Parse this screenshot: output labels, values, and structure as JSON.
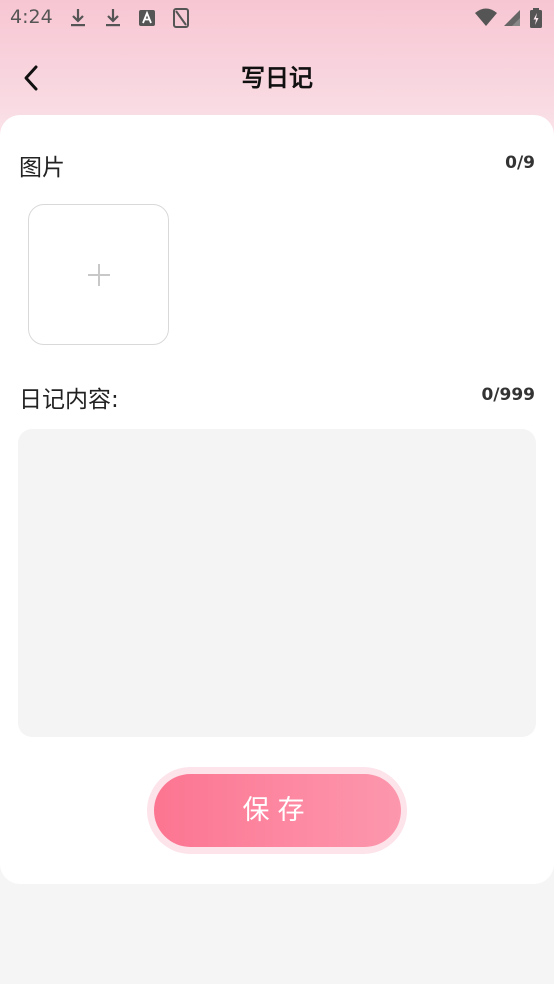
{
  "status_bar": {
    "time": "4:24",
    "icons": [
      "download-icon",
      "download-icon",
      "text-a-icon",
      "no-sim-icon",
      "wifi-icon",
      "signal-icon",
      "battery-charging-icon"
    ]
  },
  "header": {
    "title": "写日记",
    "back_icon": "chevron-left-icon"
  },
  "photos": {
    "label": "图片",
    "counter": "0/9",
    "add_icon": "plus-icon"
  },
  "content": {
    "label": "日记内容:",
    "counter": "0/999",
    "value": "",
    "placeholder": ""
  },
  "save_button": {
    "label": "保存"
  },
  "colors": {
    "accent": "#fc7591",
    "header_gradient_top": "#f7c6d3",
    "background": "#f5f5f5",
    "textarea_bg": "#f4f4f4"
  }
}
